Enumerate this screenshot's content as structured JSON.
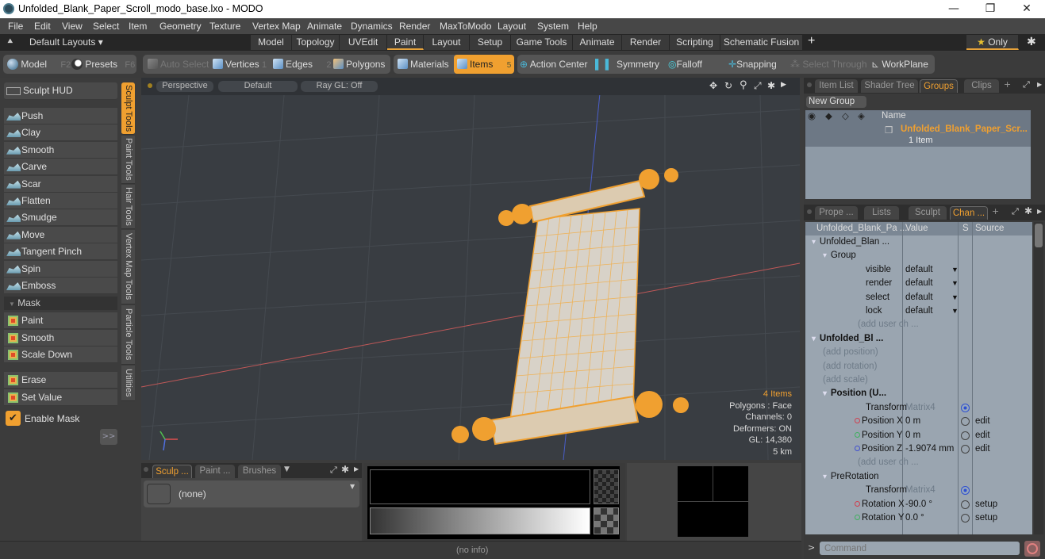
{
  "window": {
    "title": "Unfolded_Blank_Paper_Scroll_modo_base.lxo - MODO",
    "controls": [
      "—",
      "❐",
      "✕"
    ]
  },
  "menu": [
    "File",
    "Edit",
    "View",
    "Select",
    "Item",
    "Geometry",
    "Texture",
    "Vertex Map",
    "Animate",
    "Dynamics",
    "Render",
    "MaxToModo",
    "Layout",
    "System",
    "Help"
  ],
  "layouts": {
    "dropdown_label": "Default Layouts ▾",
    "tabs": [
      "Model",
      "Topology",
      "UVEdit",
      "Paint",
      "Layout",
      "Setup",
      "Game Tools",
      "Animate",
      "Render",
      "Scripting",
      "Schematic Fusion"
    ],
    "active_tab": "Paint",
    "add_label": "+",
    "only_label": "Only",
    "accent_color": "#e8a33a"
  },
  "toolbar": {
    "model_label": "Model",
    "model_key": "F2",
    "presets_label": "Presets",
    "presets_key": "F6",
    "auto_select": "Auto Select",
    "vertices": "Vertices",
    "vertices_key": "1",
    "edges": "Edges",
    "edges_key": "2",
    "polygons": "Polygons",
    "materials": "Materials",
    "items": "Items",
    "items_key": "5",
    "action_center": "Action Center",
    "symmetry": "Symmetry",
    "falloff": "Falloff",
    "snapping": "Snapping",
    "select_through": "Select Through",
    "workplane": "WorkPlane"
  },
  "left_panel": {
    "sculpt_hud": "Sculpt HUD",
    "tools": [
      "Push",
      "Clay",
      "Smooth",
      "Carve",
      "Scar",
      "Flatten",
      "Smudge",
      "Move",
      "Tangent Pinch",
      "Spin",
      "Emboss"
    ],
    "mask_header": "Mask",
    "mask_tools": [
      "Paint",
      "Smooth",
      "Scale Down"
    ],
    "mask_tools2": [
      "Erase",
      "Set Value"
    ],
    "enable_mask": "Enable Mask",
    "enable_mask_checked": true,
    "more_button": ">>",
    "vertical_tabs": [
      "Sculpt Tools",
      "Paint Tools",
      "Hair Tools",
      "Vertex Map Tools",
      "Particle Tools",
      "Utilities"
    ],
    "active_vertical_tab": "Sculpt Tools"
  },
  "viewport": {
    "view_mode": "Perspective",
    "shading": "Default",
    "raygl": "Ray GL: Off",
    "info": {
      "items": "4 Items",
      "polygons": "Polygons : Face",
      "channels": "Channels: 0",
      "deformers": "Deformers: ON",
      "gl": "GL: 14,380",
      "scale": "5 km"
    }
  },
  "bottom_panel": {
    "tabs": [
      "Sculp ...",
      "Paint ...",
      "Brushes"
    ],
    "active_tab": "Sculp ...",
    "preset_value": "(none)"
  },
  "status": {
    "info": "(no info)"
  },
  "right_top": {
    "tabs": [
      "Item List",
      "Shader Tree",
      "Groups",
      "Clips"
    ],
    "active_tab": "Groups",
    "new_group": "New Group",
    "column_name": "Name",
    "group_name": "Unfolded_Blank_Paper_Scr...",
    "group_count": "1 Item"
  },
  "right_bottom": {
    "tabs": [
      "Prope ...",
      "Lists",
      "Sculpt",
      "Chan ..."
    ],
    "active_tab": "Chan ...",
    "columns": [
      "Unfolded_Blank_Pa ...",
      "Value",
      "S",
      "Source"
    ],
    "rows": [
      {
        "indent": 0,
        "name": "Unfolded_Blan ...",
        "value": "",
        "src": "",
        "style": "item"
      },
      {
        "indent": 1,
        "name": "Group",
        "value": "",
        "src": "",
        "style": "item"
      },
      {
        "indent": 2,
        "name": "visible",
        "value": "default",
        "src": "",
        "style": "dd"
      },
      {
        "indent": 2,
        "name": "render",
        "value": "default",
        "src": "",
        "style": "dd"
      },
      {
        "indent": 2,
        "name": "select",
        "value": "default",
        "src": "",
        "style": "dd"
      },
      {
        "indent": 2,
        "name": "lock",
        "value": "default",
        "src": "",
        "style": "dd"
      },
      {
        "indent": 2,
        "name": "(add user ch ...",
        "value": "",
        "src": "",
        "style": "dim"
      },
      {
        "indent": 0,
        "name": "Unfolded_Bl ...",
        "value": "",
        "src": "",
        "style": "bold"
      },
      {
        "indent": 1,
        "name": "(add position)",
        "value": "",
        "src": "",
        "style": "dim"
      },
      {
        "indent": 1,
        "name": "(add rotation)",
        "value": "",
        "src": "",
        "style": "dim"
      },
      {
        "indent": 1,
        "name": "(add scale)",
        "value": "",
        "src": "",
        "style": "dim"
      },
      {
        "indent": 1,
        "name": "Position (U...",
        "value": "",
        "src": "",
        "style": "bold"
      },
      {
        "indent": 2,
        "name": "Transform",
        "value": "Matrix4",
        "src": "",
        "style": "matrix"
      },
      {
        "indent": 2,
        "name": "Position X",
        "value": "0 m",
        "src": "edit",
        "style": "x"
      },
      {
        "indent": 2,
        "name": "Position Y",
        "value": "0 m",
        "src": "edit",
        "style": "y"
      },
      {
        "indent": 2,
        "name": "Position Z",
        "value": "-1.9074 mm",
        "src": "edit",
        "style": "z"
      },
      {
        "indent": 2,
        "name": "(add user ch ...",
        "value": "",
        "src": "",
        "style": "dim"
      },
      {
        "indent": 1,
        "name": "PreRotation",
        "value": "",
        "src": "",
        "style": "item"
      },
      {
        "indent": 2,
        "name": "Transform",
        "value": "Matrix4",
        "src": "",
        "style": "matrix"
      },
      {
        "indent": 2,
        "name": "Rotation X",
        "value": "-90.0 °",
        "src": "setup",
        "style": "x"
      },
      {
        "indent": 2,
        "name": "Rotation Y",
        "value": "0.0 °",
        "src": "setup",
        "style": "y"
      }
    ],
    "command_placeholder": "Command"
  }
}
